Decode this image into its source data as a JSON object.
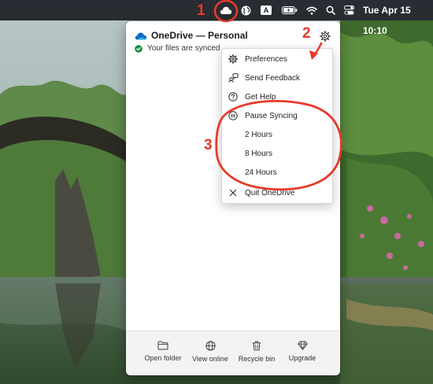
{
  "menubar": {
    "input_indicator": "A",
    "clock": "Tue Apr 15  10:10",
    "icons": [
      "onedrive-cloud-icon",
      "globe-icon",
      "input-source-icon",
      "battery-icon",
      "wifi-icon",
      "search-icon",
      "control-center-icon"
    ]
  },
  "panel": {
    "title": "OneDrive — Personal",
    "status": "Your files are synced",
    "settings_icon": "gear-icon"
  },
  "menu": {
    "items": [
      {
        "label": "Preferences",
        "icon": "gear-icon"
      },
      {
        "label": "Send Feedback",
        "icon": "feedback-icon"
      },
      {
        "label": "Get Help",
        "icon": "help-icon"
      },
      {
        "label": "Pause Syncing",
        "icon": "pause-icon"
      },
      {
        "label": "2 Hours",
        "icon": ""
      },
      {
        "label": "8 Hours",
        "icon": ""
      },
      {
        "label": "24 Hours",
        "icon": ""
      },
      {
        "label": "Quit OneDrive",
        "icon": "close-icon"
      }
    ]
  },
  "footer": {
    "buttons": [
      {
        "label": "Open folder",
        "icon": "folder-icon"
      },
      {
        "label": "View online",
        "icon": "globe-icon"
      },
      {
        "label": "Recycle bin",
        "icon": "trash-icon"
      },
      {
        "label": "Upgrade",
        "icon": "diamond-icon"
      }
    ]
  },
  "annotations": {
    "step1": "1",
    "step2": "2",
    "step3": "3",
    "color": "#e8392b"
  },
  "colors": {
    "onedrive_blue": "#0f6cbd",
    "synced_green": "#1e8b3e",
    "panel_bg": "#ffffff",
    "footer_bg": "#f3f3f3"
  }
}
